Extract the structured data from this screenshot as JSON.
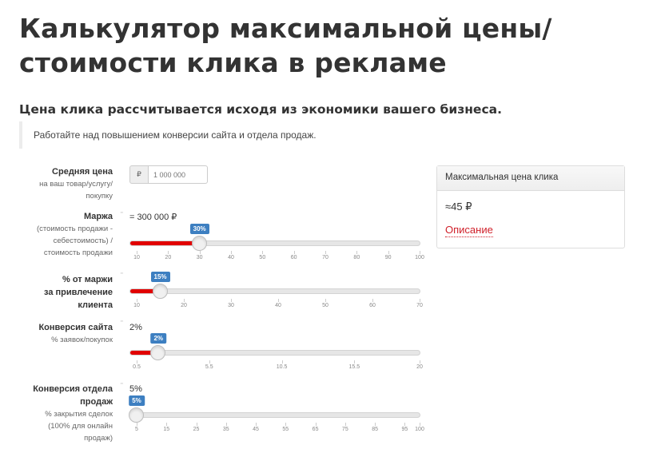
{
  "header": {
    "title_line1": "Калькулятор максимальной цены/",
    "title_line2": "стоимости клика в рекламе",
    "subtitle": "Цена клика рассчитывается исходя из экономики вашего бизнеса.",
    "callout": "Работайте над повышением конверсии сайта и отдела продаж."
  },
  "fields": {
    "avg_price": {
      "label": "Средняя цена",
      "hint1": "на ваш товар/услугу/",
      "hint2": "покупку",
      "currency": "₽",
      "placeholder": "1 000 000"
    },
    "margin": {
      "label": "Маржа",
      "hint1": "(стоимость продажи -",
      "hint2": "себестоимость) /",
      "hint3": "стоимость продажи",
      "computed": "= 300 000 ₽",
      "value_label": "30%",
      "value": 30,
      "min": 10,
      "max": 100,
      "ticks": [
        "10",
        "20",
        "30",
        "40",
        "50",
        "60",
        "70",
        "80",
        "90",
        "100"
      ]
    },
    "acquisition": {
      "label1": "% от маржи",
      "label2": "за привлечение",
      "label3": "клиента",
      "value_label": "15%",
      "value": 15,
      "min": 10,
      "max": 70,
      "ticks": [
        "10",
        "20",
        "30",
        "40",
        "50",
        "60",
        "70"
      ]
    },
    "site_conversion": {
      "label": "Конверсия сайта",
      "hint1": "% заявок/покупок",
      "display": "2%",
      "value_label": "2%",
      "value": 2,
      "min": 0.5,
      "max": 20,
      "ticks": [
        "0.5",
        "5.5",
        "10.5",
        "15.5",
        "20"
      ]
    },
    "sales_conversion": {
      "label1": "Конверсия отдела",
      "label2": "продаж",
      "hint1": "% закрытия сделок",
      "hint2": "(100% для онлайн",
      "hint3": "продаж)",
      "display": "5%",
      "value_label": "5%",
      "value": 5,
      "min": 5,
      "max": 100,
      "ticks": [
        "5",
        "15",
        "25",
        "35",
        "45",
        "55",
        "65",
        "75",
        "85",
        "95",
        "100"
      ]
    }
  },
  "result": {
    "title": "Максимальная цена клика",
    "value": "≈45 ₽",
    "link": "Описание"
  },
  "colors": {
    "fill": "#e10000",
    "bubble": "#3d7fc1",
    "link": "#d0202a"
  }
}
